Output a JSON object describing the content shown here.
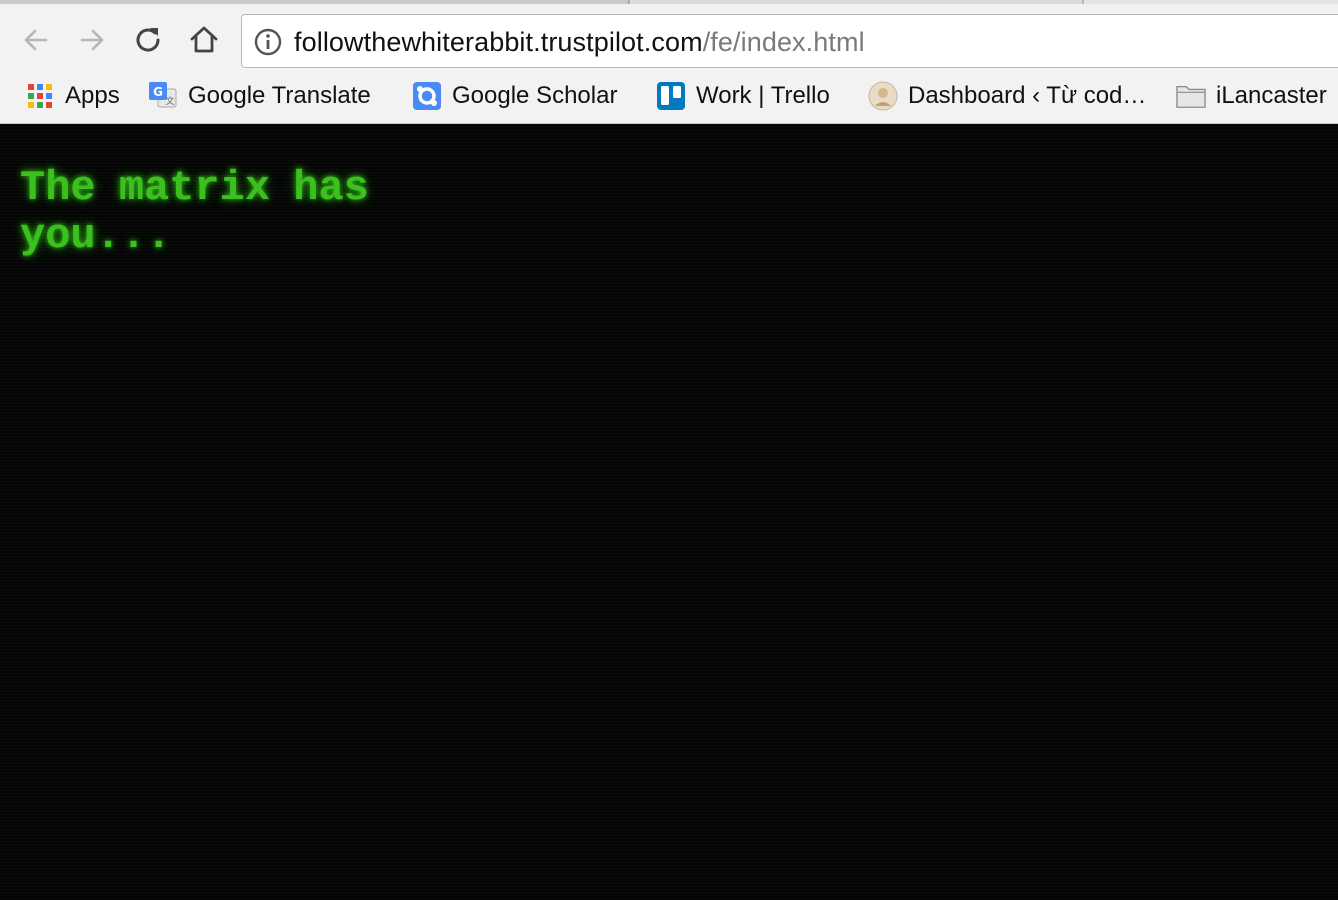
{
  "browser": {
    "nav": {
      "back_icon": "arrow-left-icon",
      "forward_icon": "arrow-right-icon",
      "reload_icon": "reload-icon",
      "home_icon": "home-icon"
    },
    "omnibox": {
      "security_icon": "info-icon",
      "url_host": "followthewhiterabbit.trustpilot.com",
      "url_path": "/fe/index.html"
    },
    "bookmarks": [
      {
        "label": "Apps",
        "icon": "apps-grid-icon"
      },
      {
        "label": "Google Translate",
        "icon": "google-translate-icon"
      },
      {
        "label": "Google Scholar",
        "icon": "google-scholar-icon"
      },
      {
        "label": "Work | Trello",
        "icon": "trello-icon"
      },
      {
        "label": "Dashboard ‹ Từ cod…",
        "icon": "site-favicon-icon"
      },
      {
        "label": "iLancaster",
        "icon": "folder-icon"
      }
    ]
  },
  "page": {
    "message": "The matrix has you...",
    "text_color": "#3cc01e",
    "background_color": "#050505"
  }
}
